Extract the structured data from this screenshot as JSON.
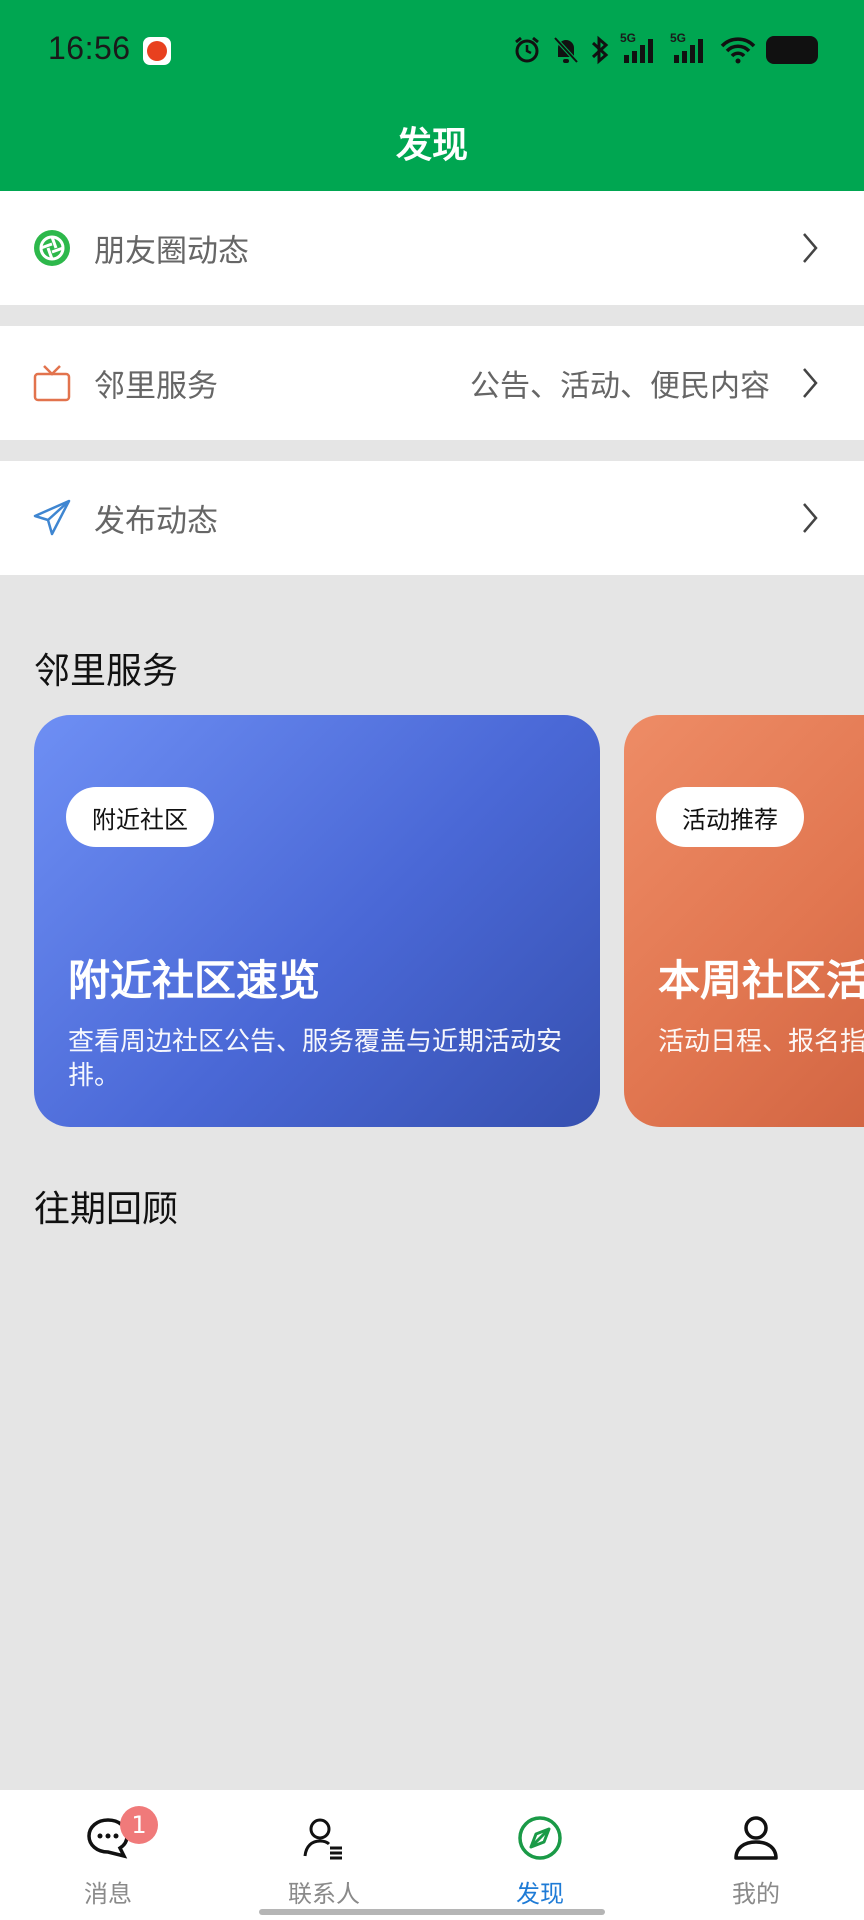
{
  "status_bar": {
    "time": "16:56",
    "network1": "5G",
    "network2": "5G"
  },
  "header": {
    "title": "发现"
  },
  "menu": [
    {
      "label": "朋友圈动态",
      "sub": "",
      "icon": "moments-icon"
    },
    {
      "label": "邻里服务",
      "sub": "公告、活动、便民内容",
      "icon": "tv-icon"
    },
    {
      "label": "发布动态",
      "sub": "",
      "icon": "send-icon"
    }
  ],
  "sections": {
    "services_title": "邻里服务",
    "review_title": "往期回顾"
  },
  "cards": [
    {
      "tag": "附近社区",
      "title": "附近社区速览",
      "desc": "查看周边社区公告、服务覆盖与近期活动安排。"
    },
    {
      "tag": "活动推荐",
      "title": "本周社区活动",
      "desc": "活动日程、报名指南与参与提示。"
    }
  ],
  "bottom_nav": [
    {
      "label": "消息",
      "badge": "1"
    },
    {
      "label": "联系人"
    },
    {
      "label": "发现",
      "active": true
    },
    {
      "label": "我的"
    }
  ],
  "colors": {
    "header_green": "#00a651",
    "active_blue": "#1e7bd6",
    "badge_red": "#f07a7a"
  }
}
